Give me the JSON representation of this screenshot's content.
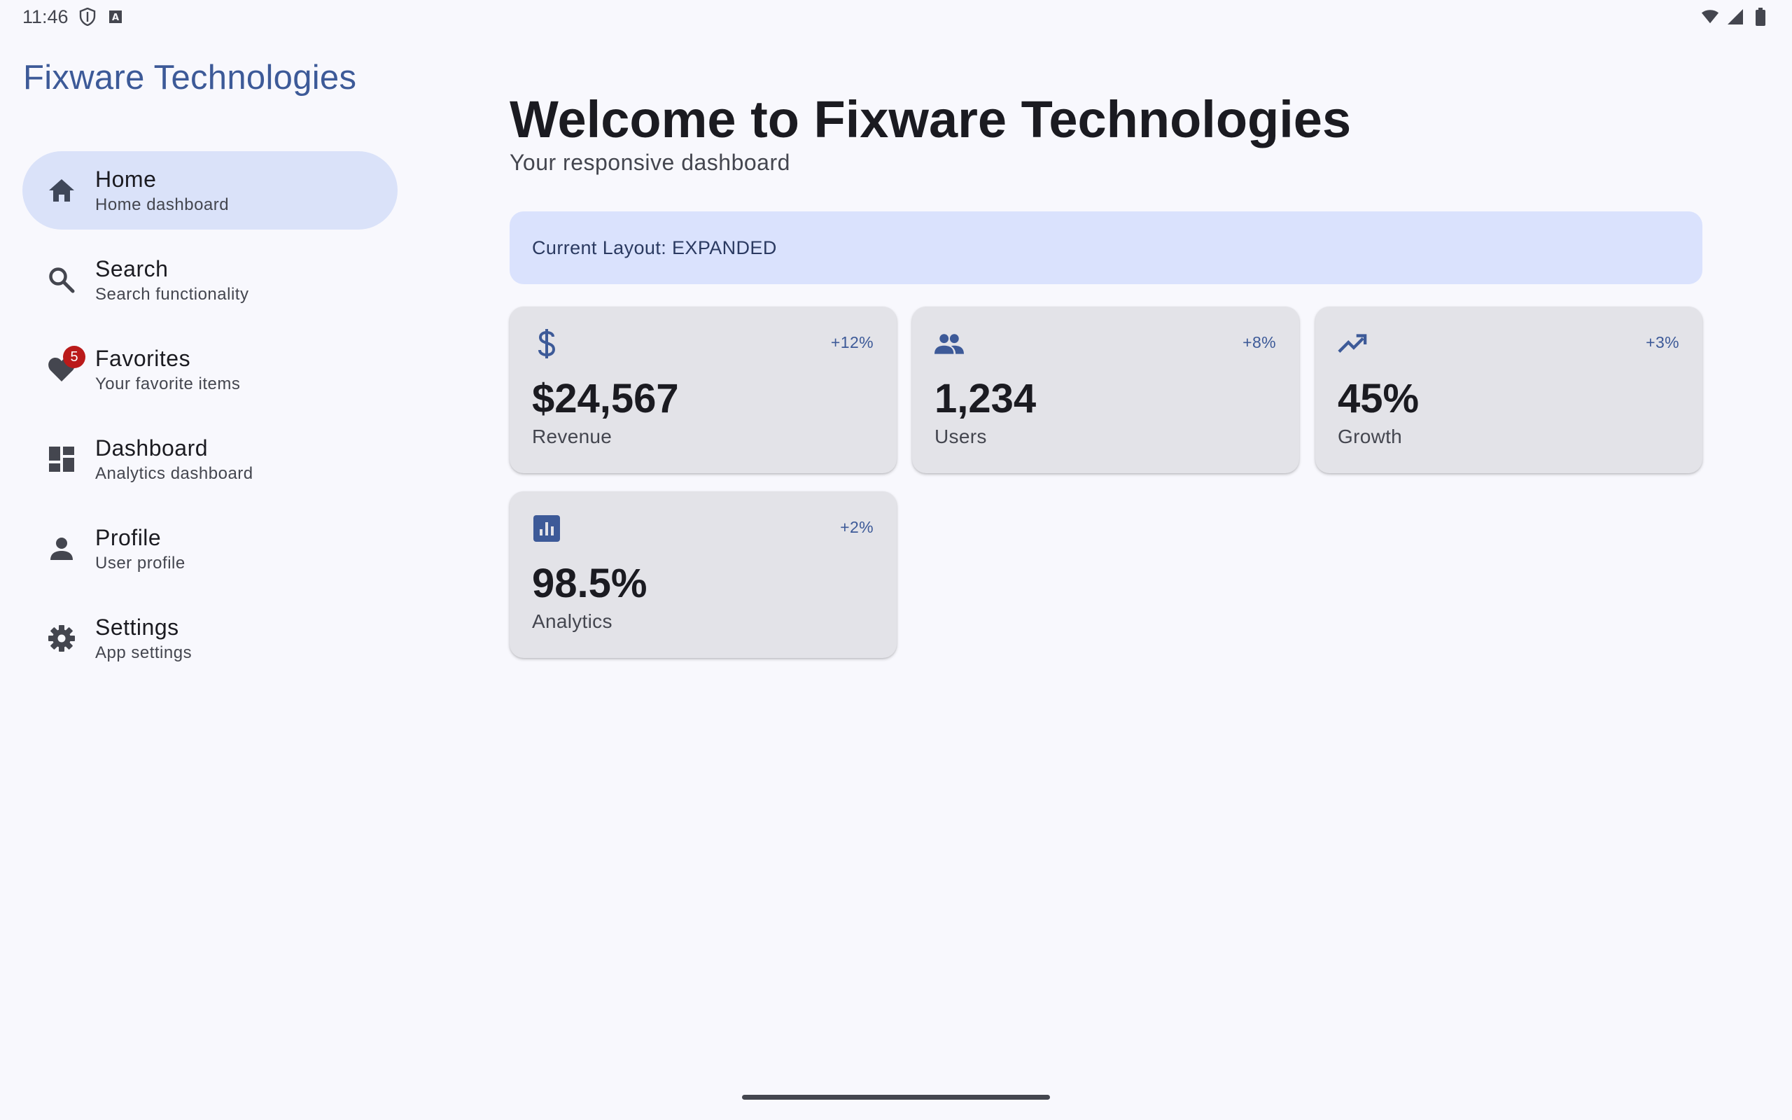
{
  "status_bar": {
    "time": "11:46",
    "left_icons": [
      "shield-icon",
      "keyboard-a-icon"
    ],
    "right_icons": [
      "wifi-icon",
      "cell-signal-icon",
      "battery-icon"
    ]
  },
  "app": {
    "title": "Fixware Technologies"
  },
  "nav": {
    "items": [
      {
        "label": "Home",
        "subtitle": "Home dashboard",
        "icon": "home-icon",
        "active": true
      },
      {
        "label": "Search",
        "subtitle": "Search functionality",
        "icon": "search-icon",
        "active": false
      },
      {
        "label": "Favorites",
        "subtitle": "Your favorite items",
        "icon": "heart-icon",
        "badge": "5",
        "active": false
      },
      {
        "label": "Dashboard",
        "subtitle": "Analytics dashboard",
        "icon": "dashboard-icon",
        "active": false
      },
      {
        "label": "Profile",
        "subtitle": "User profile",
        "icon": "person-icon",
        "active": false
      },
      {
        "label": "Settings",
        "subtitle": "App settings",
        "icon": "gear-icon",
        "active": false
      }
    ]
  },
  "main": {
    "title": "Welcome to Fixware Technologies",
    "subtitle": "Your responsive dashboard",
    "layout_banner": "Current Layout: EXPANDED",
    "cards": [
      {
        "icon": "dollar-icon",
        "change": "+12%",
        "value": "$24,567",
        "label": "Revenue"
      },
      {
        "icon": "people-icon",
        "change": "+8%",
        "value": "1,234",
        "label": "Users"
      },
      {
        "icon": "trending-up-icon",
        "change": "+3%",
        "value": "45%",
        "label": "Growth"
      },
      {
        "icon": "analytics-icon",
        "change": "+2%",
        "value": "98.5%",
        "label": "Analytics"
      }
    ]
  },
  "colors": {
    "accent": "#3d5a98",
    "active_nav_bg": "#dae2f9",
    "banner_bg": "#dae2fd",
    "card_bg": "#e3e3e8",
    "badge": "#ba1a1a",
    "background": "#f8f8fd"
  }
}
